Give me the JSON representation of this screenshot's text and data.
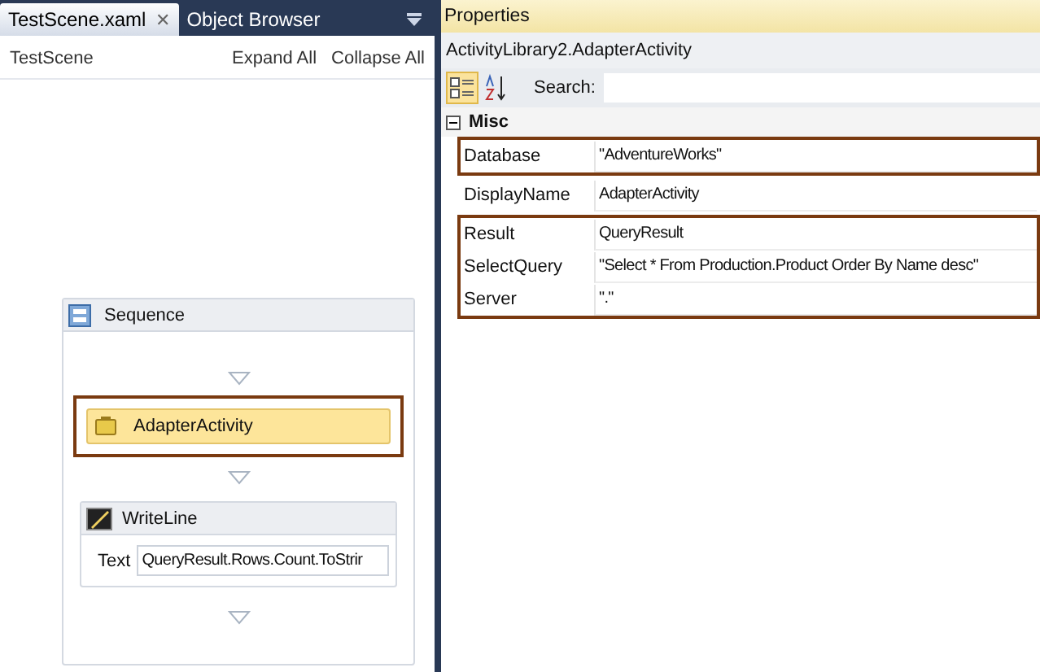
{
  "tabs": [
    {
      "label": "TestScene.xaml",
      "selected": true,
      "close": "✕"
    },
    {
      "label": "Object Browser",
      "selected": false
    }
  ],
  "designer": {
    "breadcrumb": "TestScene",
    "expand_all": "Expand All",
    "collapse_all": "Collapse All",
    "sequence": {
      "title": "Sequence",
      "activities": [
        {
          "kind": "activity",
          "title": "AdapterActivity",
          "highlighted": true
        },
        {
          "kind": "writeline",
          "title": "WriteLine",
          "field_label": "Text",
          "value": "QueryResult.Rows.Count.ToStrir"
        }
      ]
    }
  },
  "properties": {
    "title": "Properties",
    "object": "ActivityLibrary2.AdapterActivity",
    "search_label": "Search:",
    "category": {
      "name": "Misc",
      "expanded": true
    },
    "groups": [
      {
        "highlighted": true,
        "rows": [
          {
            "name": "Database",
            "value": "\"AdventureWorks\""
          }
        ]
      },
      {
        "highlighted": false,
        "rows": [
          {
            "name": "DisplayName",
            "value": "AdapterActivity"
          }
        ]
      },
      {
        "highlighted": true,
        "rows": [
          {
            "name": "Result",
            "value": "QueryResult"
          },
          {
            "name": "SelectQuery",
            "value": "\"Select * From Production.Product Order By Name desc\""
          },
          {
            "name": "Server",
            "value": "\".\""
          }
        ]
      }
    ]
  }
}
